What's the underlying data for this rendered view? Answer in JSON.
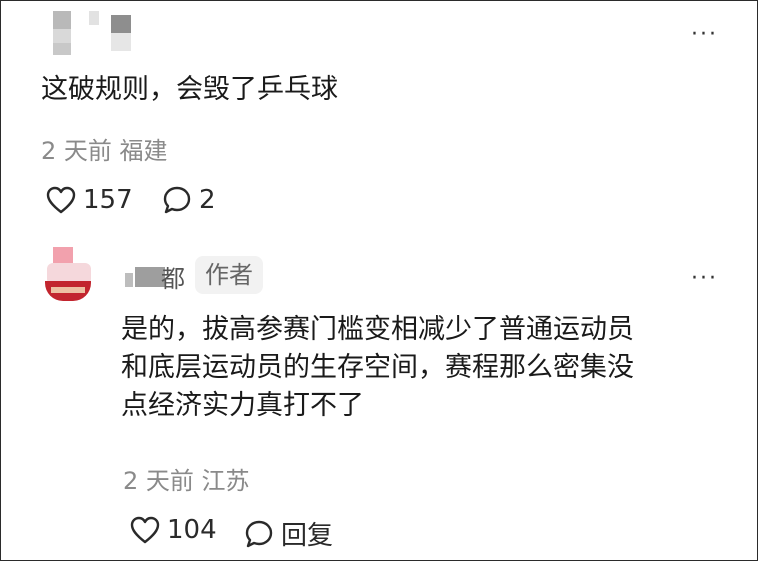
{
  "comment": {
    "text": "这破规则，会毁了乒乓球",
    "time": "2 天前",
    "location": "福建",
    "likes": "157",
    "replies": "2",
    "more": "···"
  },
  "reply": {
    "username": "都",
    "author_badge": "作者",
    "line1": "是的，拔高参赛门槛变相减少了普通运动员",
    "line2": "和底层运动员的生存空间，赛程那么密集没",
    "line3": "点经济实力真打不了",
    "time": "2 天前",
    "location": "江苏",
    "likes": "104",
    "reply_label": "回复",
    "more": "···"
  }
}
